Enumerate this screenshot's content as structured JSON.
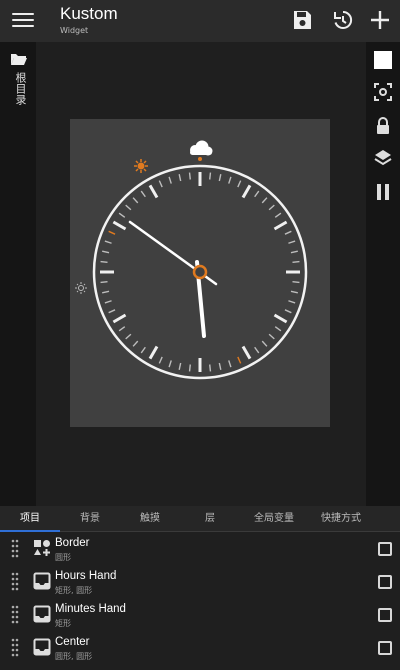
{
  "appbar": {
    "title": "Kustom",
    "subtitle": "Widget",
    "actions": [
      "save-icon",
      "history-icon",
      "add-icon"
    ]
  },
  "left_drawer": {
    "label": "根目录",
    "icon": "folder-open-icon"
  },
  "right_toolbar": [
    "white-square-icon",
    "focus-icon",
    "lock-icon",
    "layers-icon",
    "pause-icon"
  ],
  "clock_preview": {
    "weather_icons": [
      "cloud-icon",
      "sun-icon",
      "sun-outline-icon"
    ],
    "accent_color": "#e07a1f",
    "hand_color": "#ffffff",
    "tick_color": "#bdbdbd",
    "hour_value": 5.9,
    "minute_value": 51
  },
  "tabs": [
    {
      "label": "项目",
      "active": true
    },
    {
      "label": "背景",
      "active": false
    },
    {
      "label": "触摸",
      "active": false
    },
    {
      "label": "层",
      "active": false
    },
    {
      "label": "全局变量",
      "active": false
    },
    {
      "label": "快捷方式",
      "active": false
    }
  ],
  "items": [
    {
      "title": "Border",
      "subtitle": "圆形",
      "icon": "shapes-icon",
      "checked": false
    },
    {
      "title": "Hours Hand",
      "subtitle": "矩形, 圆形",
      "icon": "inbox-icon",
      "checked": false
    },
    {
      "title": "Minutes Hand",
      "subtitle": "矩形",
      "icon": "inbox-icon",
      "checked": false
    },
    {
      "title": "Center",
      "subtitle": "圆形, 圆形",
      "icon": "inbox-icon",
      "checked": false
    }
  ],
  "colors": {
    "appbar_bg": "#2b2b2b",
    "tab_indicator": "#2f6fd6",
    "preview_bg": "#404040"
  }
}
